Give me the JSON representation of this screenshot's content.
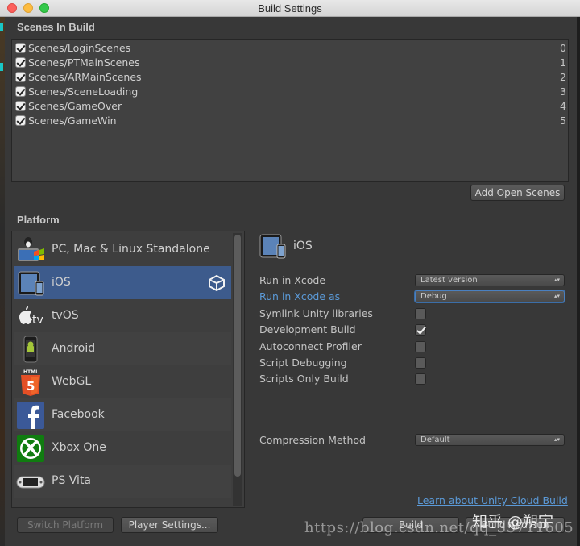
{
  "window": {
    "title": "Build Settings"
  },
  "scenes": {
    "heading": "Scenes In Build",
    "items": [
      {
        "name": "Scenes/LoginScenes",
        "index": "0",
        "checked": true
      },
      {
        "name": "Scenes/PTMainScenes",
        "index": "1",
        "checked": true
      },
      {
        "name": "Scenes/ARMainScenes",
        "index": "2",
        "checked": true
      },
      {
        "name": "Scenes/SceneLoading",
        "index": "3",
        "checked": true
      },
      {
        "name": "Scenes/GameOver",
        "index": "4",
        "checked": true
      },
      {
        "name": "Scenes/GameWin",
        "index": "5",
        "checked": true
      }
    ],
    "add_open_scenes_label": "Add Open Scenes"
  },
  "platform": {
    "heading": "Platform",
    "items": [
      {
        "label": "PC, Mac & Linux Standalone",
        "icon": "standalone-icon"
      },
      {
        "label": "iOS",
        "icon": "ipad-icon",
        "selected": true
      },
      {
        "label": "tvOS",
        "icon": "apple-tv-icon"
      },
      {
        "label": "Android",
        "icon": "android-phone-icon"
      },
      {
        "label": "WebGL",
        "icon": "html5-icon"
      },
      {
        "label": "Facebook",
        "icon": "facebook-icon"
      },
      {
        "label": "Xbox One",
        "icon": "xbox-icon"
      },
      {
        "label": "PS Vita",
        "icon": "ps-vita-icon"
      }
    ]
  },
  "settings": {
    "platform_name": "iOS",
    "run_in_xcode_label": "Run in Xcode",
    "run_in_xcode_value": "Latest version",
    "run_in_xcode_as_label": "Run in Xcode as",
    "run_in_xcode_as_value": "Debug",
    "symlink_label": "Symlink Unity libraries",
    "symlink_checked": false,
    "development_build_label": "Development Build",
    "development_build_checked": true,
    "autoconnect_label": "Autoconnect Profiler",
    "autoconnect_checked": false,
    "script_debugging_label": "Script Debugging",
    "script_debugging_checked": false,
    "scripts_only_label": "Scripts Only Build",
    "scripts_only_checked": false,
    "compression_label": "Compression Method",
    "compression_value": "Default",
    "cloud_build_link": "Learn about Unity Cloud Build"
  },
  "footer": {
    "switch_platform_label": "Switch Platform",
    "player_settings_label": "Player Settings...",
    "build_label": "Build",
    "build_and_run_label": "Build And Run"
  },
  "watermark": {
    "url": "https://blog.csdn.net/qq_35711605",
    "brand": "知乎 @朔宇"
  },
  "colors": {
    "accent": "#3d5b8c",
    "link": "#5b9ad8",
    "panel": "#383838"
  }
}
